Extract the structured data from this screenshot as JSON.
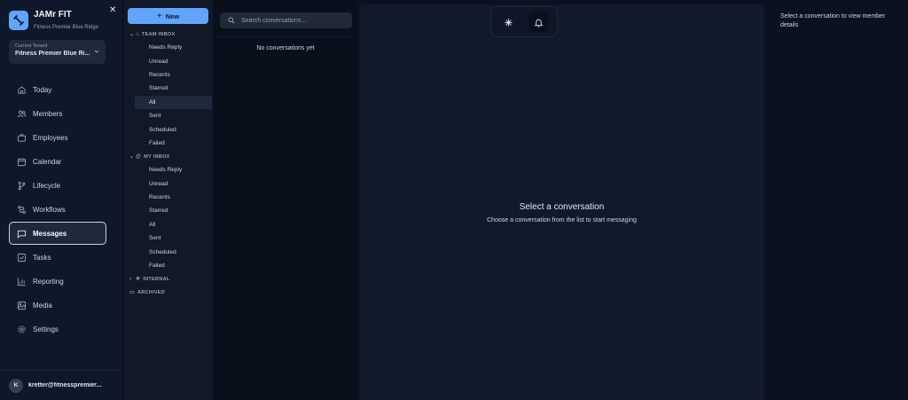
{
  "brand": {
    "name": "JAMr FIT",
    "subtitle": "Fitness Premier Blue Ridge",
    "close_glyph": "✕"
  },
  "tenant": {
    "label": "Current Tenant",
    "name": "Fitness Premier Blue Ri..."
  },
  "nav": {
    "items": [
      {
        "label": "Today",
        "icon": "home-icon"
      },
      {
        "label": "Members",
        "icon": "users-icon"
      },
      {
        "label": "Employees",
        "icon": "briefcase-icon"
      },
      {
        "label": "Calendar",
        "icon": "calendar-icon"
      },
      {
        "label": "Lifecycle",
        "icon": "branch-icon"
      },
      {
        "label": "Workflows",
        "icon": "workflow-icon"
      },
      {
        "label": "Messages",
        "icon": "message-icon",
        "active": true
      },
      {
        "label": "Tasks",
        "icon": "checkbox-icon"
      },
      {
        "label": "Reporting",
        "icon": "chart-icon"
      },
      {
        "label": "Media",
        "icon": "image-icon"
      },
      {
        "label": "Settings",
        "icon": "gear-icon"
      }
    ]
  },
  "user": {
    "initial": "K",
    "email": "kretter@fitnesspremier..."
  },
  "inbox": {
    "new_label": "New",
    "team": {
      "title": "TEAM INBOX",
      "items": [
        "Needs Reply",
        "Unread",
        "Recents",
        "Starred",
        "All",
        "Sent",
        "Scheduled",
        "Failed"
      ],
      "active": "All"
    },
    "mine": {
      "title": "MY INBOX",
      "items": [
        "Needs Reply",
        "Unread",
        "Recents",
        "Starred",
        "All",
        "Sent",
        "Scheduled",
        "Failed"
      ]
    },
    "internal": {
      "title": "INTERNAL"
    },
    "archived": {
      "title": "ARCHIVED"
    }
  },
  "conversations": {
    "search_placeholder": "Search conversations...",
    "empty_text": "No conversations yet"
  },
  "main": {
    "title": "Select a conversation",
    "subtitle": "Choose a conversation from the list to start messaging"
  },
  "details": {
    "placeholder": "Select a conversation to view member details"
  },
  "colors": {
    "accent": "#60a5fa",
    "sidebar_bg": "#0f172a",
    "page_bg": "#0b1120"
  }
}
